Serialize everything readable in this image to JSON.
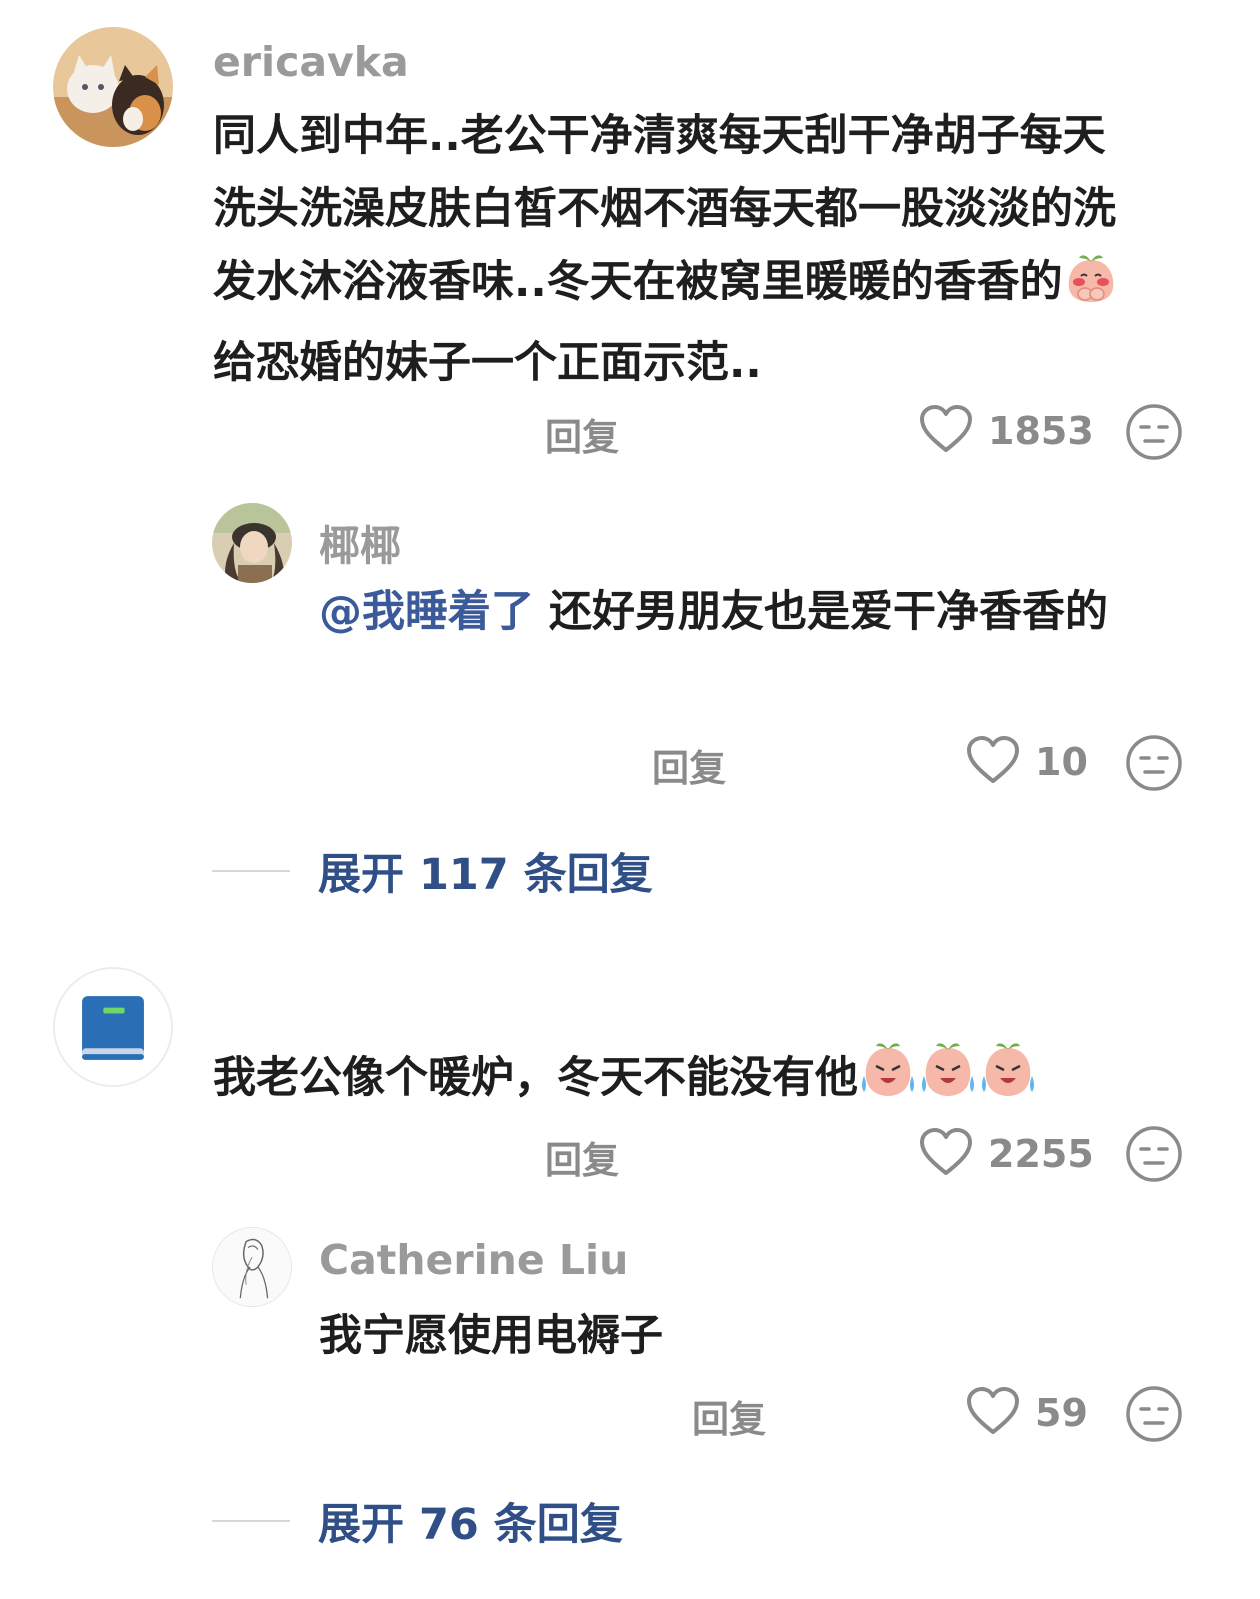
{
  "comments": [
    {
      "username": "ericavka",
      "text_before_emoji": "同人到中年..老公干净清爽每天刮干净胡子每天洗头洗澡皮肤白皙不烟不酒每天都一股淡淡的洗发水沐浴液香味..冬天在被窝里暖暖的香香的",
      "emoji": "blushing-peach-emoji",
      "text_after_emoji": " 给恐婚的妹子一个正面示范..",
      "reply_label": "回复",
      "likes": "1853",
      "replies": [
        {
          "username": "椰椰",
          "mention": "@我睡着了",
          "text": " 还好男朋友也是爱干净香香的",
          "reply_label": "回复",
          "likes": "10"
        }
      ],
      "expand_label": "展开 117 条回复"
    },
    {
      "username": "",
      "text": "我老公像个暖炉，冬天不能没有他",
      "emoji": "crying-peach-emoji",
      "reply_label": "回复",
      "likes": "2255",
      "replies": [
        {
          "username": "Catherine Liu",
          "text": "我宁愿使用电褥子",
          "reply_label": "回复",
          "likes": "59"
        }
      ],
      "expand_label": "展开 76 条回复"
    }
  ],
  "icons": {
    "like": "heart-outline-icon",
    "dislike": "neutral-face-icon"
  },
  "colors": {
    "text": "#1e1e1e",
    "muted": "#8a8a8a",
    "username": "#9a9a9a",
    "link": "#2f4f86",
    "mention": "#3a5a9a"
  }
}
